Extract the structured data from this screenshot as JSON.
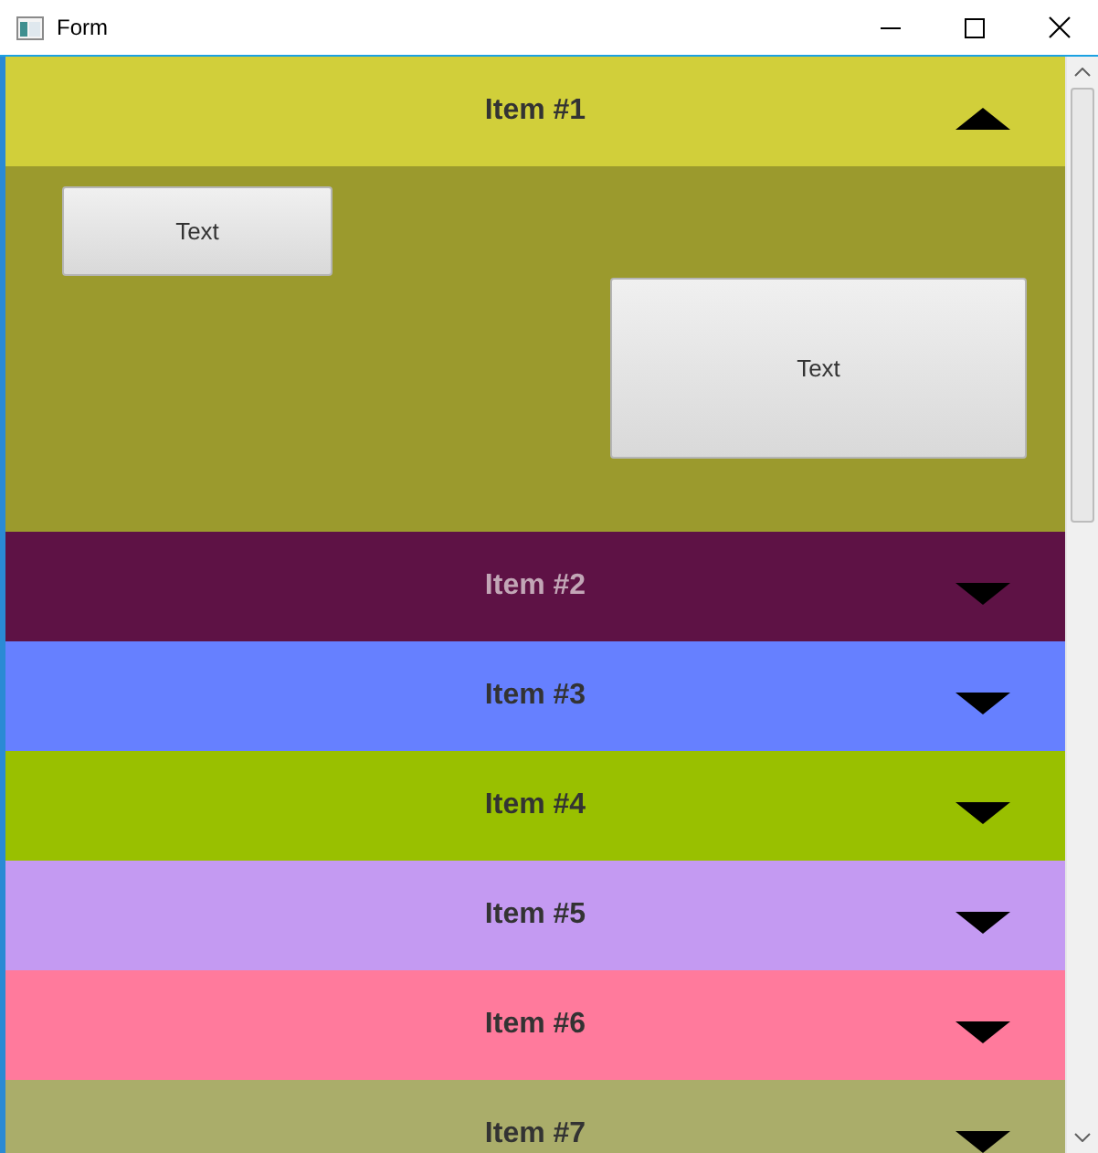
{
  "window": {
    "title": "Form"
  },
  "accordion": {
    "items": [
      {
        "label": "Item #1",
        "expanded": true,
        "color": "#d1cf3a",
        "buttons": [
          "Text",
          "Text"
        ]
      },
      {
        "label": "Item #2",
        "expanded": false,
        "color": "#5e1245"
      },
      {
        "label": "Item #3",
        "expanded": false,
        "color": "#6680ff"
      },
      {
        "label": "Item #4",
        "expanded": false,
        "color": "#99c000"
      },
      {
        "label": "Item #5",
        "expanded": false,
        "color": "#c49af2"
      },
      {
        "label": "Item #6",
        "expanded": false,
        "color": "#ff7a9c"
      },
      {
        "label": "Item #7",
        "expanded": false,
        "color": "#aaad6a"
      }
    ]
  }
}
